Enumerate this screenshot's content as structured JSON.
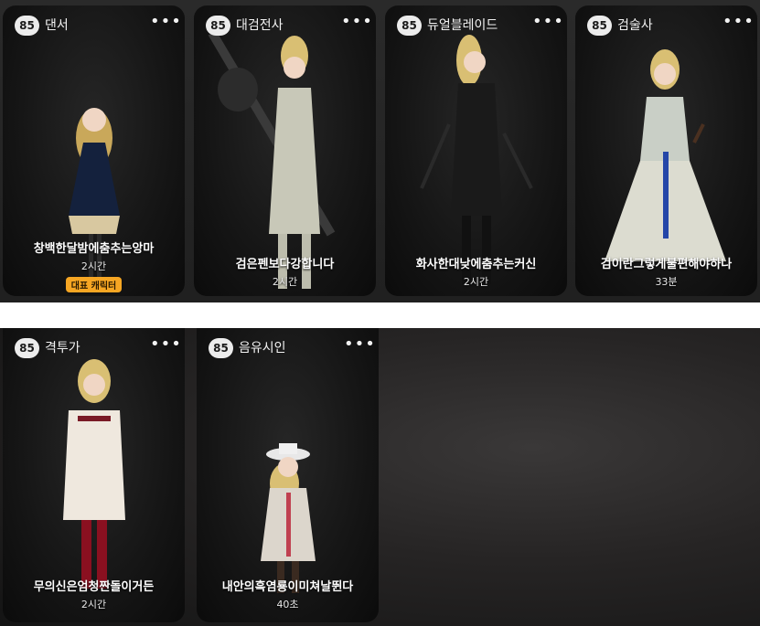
{
  "rows": [
    [
      {
        "level": "85",
        "class_name": "댄서",
        "char_name": "창백한달밤에춤추는앙마",
        "playtime": "2시간",
        "tag": "대표 캐릭터"
      },
      {
        "level": "85",
        "class_name": "대검전사",
        "char_name": "검은펜보다강합니다",
        "playtime": "2시간"
      },
      {
        "level": "85",
        "class_name": "듀얼블레이드",
        "char_name": "화사한대낮에춤추는커신",
        "playtime": "2시간"
      },
      {
        "level": "85",
        "class_name": "검술사",
        "char_name": "검이란그렇게불편해야하나",
        "playtime": "33분"
      }
    ],
    [
      {
        "level": "85",
        "class_name": "격투가",
        "char_name": "무의신은엄청짠돌이거든",
        "playtime": "2시간"
      },
      {
        "level": "85",
        "class_name": "음유시인",
        "char_name": "내안의흑염룡이미쳐날뛴다",
        "playtime": "40초"
      }
    ]
  ],
  "more_icon": "•••",
  "colors": {
    "tag_bg": "#f6a623",
    "badge_bg": "#ececec",
    "card_bg": "#151515"
  }
}
